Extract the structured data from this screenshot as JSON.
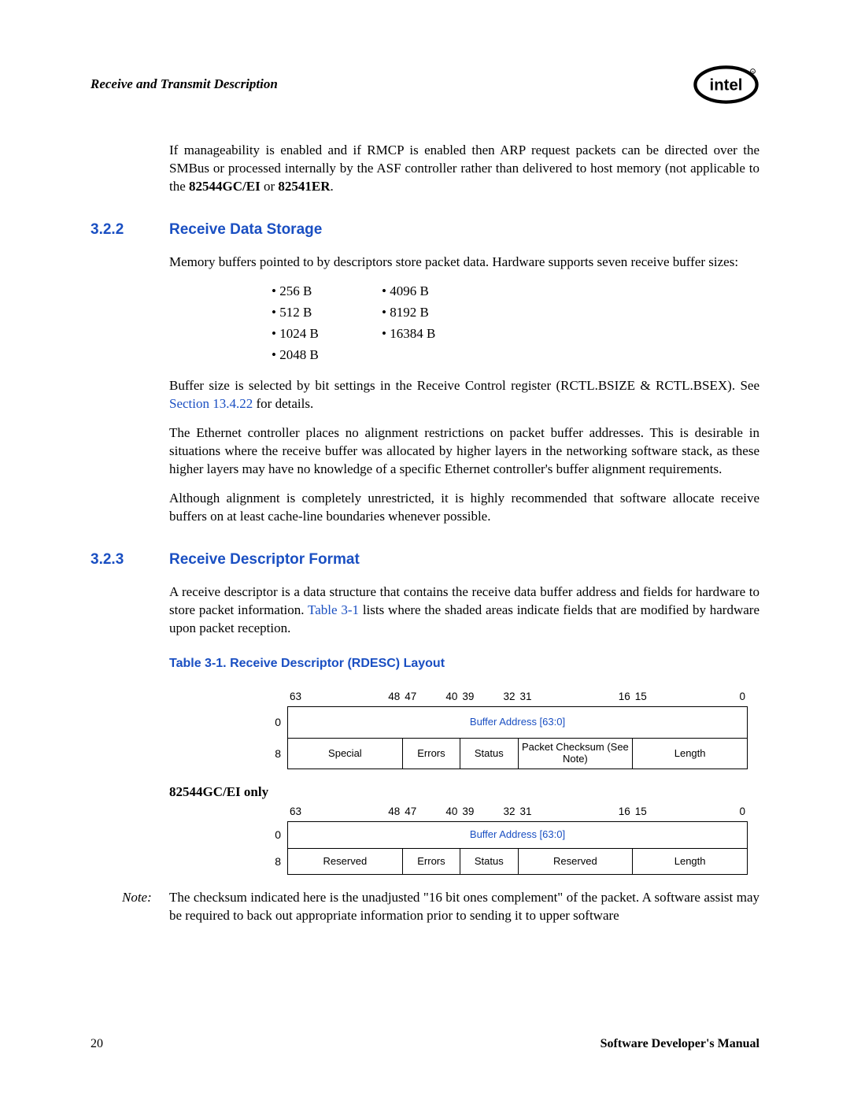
{
  "header": {
    "title": "Receive and Transmit Description",
    "logo_name": "intel"
  },
  "para_intro": "If manageability is enabled and if RMCP is enabled then ARP request packets can be directed over the SMBus or processed internally by the ASF controller rather than delivered to host memory (not applicable to the ",
  "para_intro_bold1": "82544GC/EI",
  "para_intro_mid": " or ",
  "para_intro_bold2": "82541ER",
  "para_intro_end": ".",
  "sec_322": {
    "num": "3.2.2",
    "title": "Receive Data Storage",
    "p1": "Memory buffers pointed to by descriptors store packet data. Hardware supports seven receive buffer sizes:",
    "buffers_left": [
      "256 B",
      "512 B",
      "1024 B",
      "2048 B"
    ],
    "buffers_right": [
      "4096 B",
      "8192 B",
      "16384 B"
    ],
    "p2_a": "Buffer size is selected by bit settings in the Receive Control register (RCTL.BSIZE & RCTL.BSEX). See ",
    "p2_link": "Section 13.4.22",
    "p2_b": " for details.",
    "p3": "The Ethernet controller places no alignment restrictions on packet buffer addresses. This is desirable in situations where the receive buffer was allocated by higher layers in the networking software stack, as these higher layers may have no knowledge of a specific Ethernet controller's buffer alignment requirements.",
    "p4": "Although alignment is completely unrestricted, it is highly recommended that software allocate receive buffers on at least cache-line boundaries whenever possible."
  },
  "sec_323": {
    "num": "3.2.3",
    "title": "Receive Descriptor Format",
    "p1_a": "A receive descriptor is a data structure that contains the receive data buffer address and fields for hardware to store packet information. ",
    "p1_link": "Table 3-1",
    "p1_b": " lists where the shaded areas indicate fields that are modified by hardware upon packet reception.",
    "table_title": "Table 3-1. Receive Descriptor (RDESC) Layout"
  },
  "chart_data": [
    {
      "type": "table",
      "name": "rdesc-layout-general",
      "bit_labels": [
        "63",
        "48",
        "47",
        "40",
        "39",
        "32",
        "31",
        "16",
        "15",
        "0"
      ],
      "rows": [
        {
          "offset": "0",
          "cells": [
            {
              "label": "Buffer Address [63:0]",
              "span": 64,
              "link": true
            }
          ]
        },
        {
          "offset": "8",
          "cells": [
            {
              "label": "Special",
              "span": 16
            },
            {
              "label": "Errors",
              "span": 8
            },
            {
              "label": "Status",
              "span": 8
            },
            {
              "label": "Packet Checksum (See Note)",
              "span": 16
            },
            {
              "label": "Length",
              "span": 16
            }
          ]
        }
      ]
    },
    {
      "type": "table",
      "name": "rdesc-layout-82544gc-ei",
      "variant_label": "82544GC/EI only",
      "bit_labels": [
        "63",
        "48",
        "47",
        "40",
        "39",
        "32",
        "31",
        "16",
        "15",
        "0"
      ],
      "rows": [
        {
          "offset": "0",
          "cells": [
            {
              "label": "Buffer Address [63:0]",
              "span": 64,
              "link": true
            }
          ]
        },
        {
          "offset": "8",
          "cells": [
            {
              "label": "Reserved",
              "span": 16
            },
            {
              "label": "Errors",
              "span": 8
            },
            {
              "label": "Status",
              "span": 8
            },
            {
              "label": "Reserved",
              "span": 16
            },
            {
              "label": "Length",
              "span": 16
            }
          ]
        }
      ]
    }
  ],
  "note": {
    "label": "Note:",
    "body": "The checksum indicated here is the unadjusted \"16 bit ones complement\" of the packet. A software assist may be required to back out appropriate information prior to sending it to upper software"
  },
  "footer": {
    "page": "20",
    "doc": "Software Developer's Manual"
  }
}
